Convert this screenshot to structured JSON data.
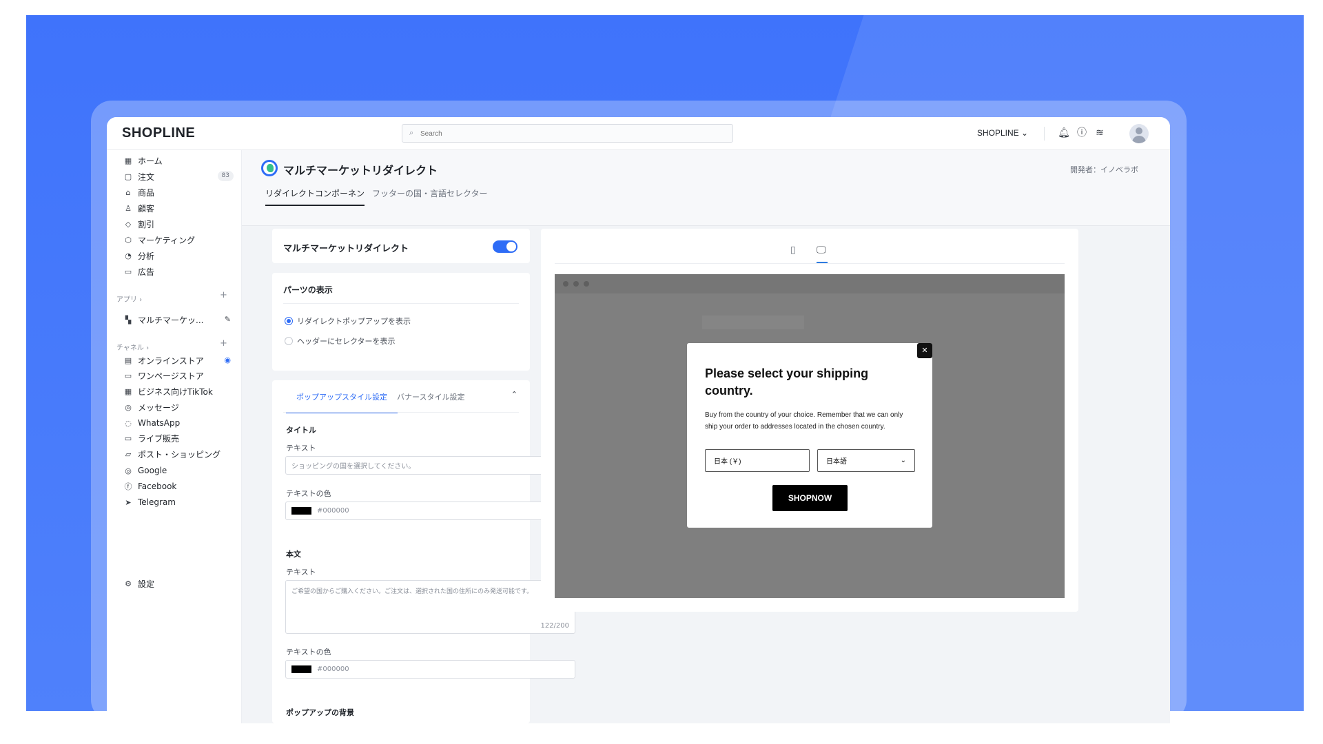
{
  "topbar": {
    "logo": "SHOPLINE",
    "search_placeholder": "Search",
    "store_name": "SHOPLINE"
  },
  "sidebar": {
    "items": [
      {
        "label": "ホーム",
        "icon": "home-icon"
      },
      {
        "label": "注文",
        "icon": "order-icon",
        "badge": "83"
      },
      {
        "label": "商品",
        "icon": "product-icon"
      },
      {
        "label": "顧客",
        "icon": "customer-icon"
      },
      {
        "label": "割引",
        "icon": "discount-icon"
      },
      {
        "label": "マーケティング",
        "icon": "marketing-icon"
      },
      {
        "label": "分析",
        "icon": "analytics-icon"
      },
      {
        "label": "広告",
        "icon": "ads-icon"
      }
    ],
    "apps_label": "アプリ ›",
    "app_item": "マルチマーケッ...",
    "channels_label": "チャネル ›",
    "channels": [
      {
        "label": "オンラインストア",
        "icon": "store-icon"
      },
      {
        "label": "ワンページストア",
        "icon": "onepage-icon"
      },
      {
        "label": "ビジネス向けTikTok",
        "icon": "tiktok-icon"
      },
      {
        "label": "メッセージ",
        "icon": "message-icon"
      },
      {
        "label": "WhatsApp",
        "icon": "whatsapp-icon"
      },
      {
        "label": "ライブ販売",
        "icon": "live-icon"
      },
      {
        "label": "ポスト・ショッピング",
        "icon": "post-icon"
      },
      {
        "label": "Google",
        "icon": "google-icon"
      },
      {
        "label": "Facebook",
        "icon": "facebook-icon"
      },
      {
        "label": "Telegram",
        "icon": "telegram-icon"
      }
    ],
    "settings": "設定"
  },
  "header": {
    "title": "マルチマーケットリダイレクト",
    "developer": "開発者：イノベラボ",
    "tabs": [
      "リダイレクトコンポーネン",
      "フッターの国・言語セレクター"
    ]
  },
  "main": {
    "toggle_card_title": "マルチマーケットリダイレクト",
    "toggle_on": true,
    "parts_title": "パーツの表示",
    "radios": [
      "リダイレクトポップアップを表示",
      "ヘッダーにセレクターを表示"
    ],
    "style_tabs": [
      "ポップアップスタイル設定",
      "バナースタイル設定"
    ],
    "title_section": "タイトル",
    "text_label": "テキスト",
    "title_text": "ショッピングの国を選択してください。",
    "text_color_label": "テキストの色",
    "title_color": "#000000",
    "body_section": "本文",
    "body_text_label": "テキスト",
    "body_text": "ご希望の国からご購入ください。ご注文は、選択された国の住所にのみ発送可能です。",
    "body_counter": "122/200",
    "body_color_label": "テキストの色",
    "body_color": "#000000",
    "bg_section": "ポップアップの背景"
  },
  "preview": {
    "modal_title": "Please select your shipping country.",
    "modal_body": "Buy from the country of your choice. Remember that we can only ship your order to addresses located in the chosen country.",
    "country": "日本 (￥)",
    "language": "日本語",
    "button": "SHOPNOW"
  },
  "colors": {
    "accent": "#2e6cf6",
    "background": "#3f73fb"
  }
}
